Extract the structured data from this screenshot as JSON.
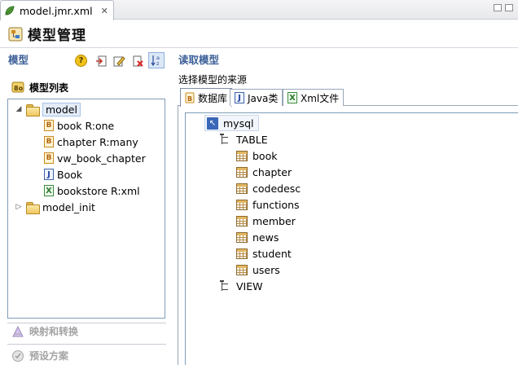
{
  "editor_tab": {
    "title": "model.jmr.xml",
    "close": "✕"
  },
  "header": {
    "title": "模型管理"
  },
  "left_panel": {
    "title": "模型",
    "toolbar": [
      "help-icon",
      "import-icon",
      "edit-icon",
      "delete-icon",
      "sort-az-icon"
    ],
    "model_list_label": "模型列表",
    "tree": [
      {
        "label": "model",
        "icon": "folder-icon",
        "expanded": true,
        "selected": true
      },
      {
        "label": "book R:one",
        "icon": "bean-icon"
      },
      {
        "label": "chapter R:many",
        "icon": "bean-icon"
      },
      {
        "label": "vw_book_chapter",
        "icon": "bean-icon"
      },
      {
        "label": "Book",
        "icon": "java-icon"
      },
      {
        "label": "bookstore R:xml",
        "icon": "xml-icon"
      },
      {
        "label": "model_init",
        "icon": "folder-icon",
        "expanded": false
      }
    ],
    "sections": [
      "映射和转换",
      "预设方案"
    ]
  },
  "right_panel": {
    "title": "读取模型",
    "subtitle": "选择模型的来源",
    "tabs": [
      {
        "label": "数据库",
        "icon": "database-icon",
        "active": true
      },
      {
        "label": "Java类",
        "icon": "java-icon"
      },
      {
        "label": "Xml文件",
        "icon": "xml-icon"
      }
    ],
    "db_tree": {
      "root": "mysql",
      "groups": [
        {
          "label": "TABLE",
          "items": [
            "book",
            "chapter",
            "codedesc",
            "functions",
            "member",
            "news",
            "student",
            "users"
          ]
        },
        {
          "label": "VIEW",
          "items": []
        }
      ]
    }
  },
  "colors": {
    "section_title": "#3c5f98",
    "tree_border": "#7f9db9",
    "selection": "#e3ecf8"
  }
}
